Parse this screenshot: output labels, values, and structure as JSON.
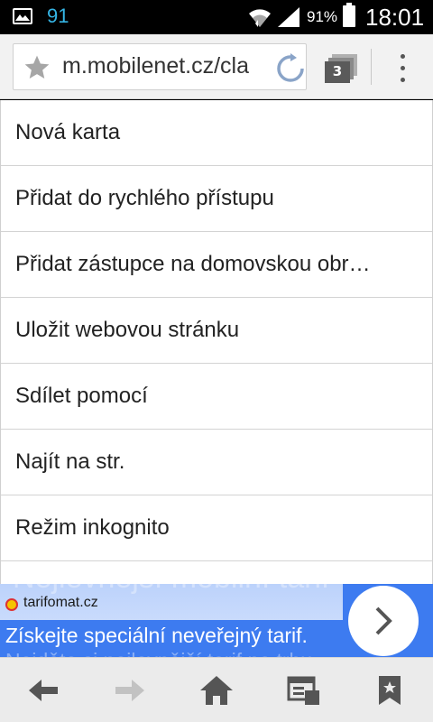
{
  "status_bar": {
    "notification_count": "91",
    "battery_percent": "91%",
    "time": "18:01",
    "icons": [
      "gallery-icon",
      "wifi-icon",
      "signal-icon",
      "battery-icon"
    ]
  },
  "toolbar": {
    "url": "m.mobilenet.cz/cla",
    "tab_count": "3",
    "icons": [
      "star-icon",
      "reload-icon",
      "tabs-icon",
      "overflow-menu-icon"
    ]
  },
  "menu": {
    "items": [
      {
        "label": "Nová karta"
      },
      {
        "label": "Přidat do rychlého přístupu"
      },
      {
        "label": "Přidat zástupce na domovskou obr…"
      },
      {
        "label": "Uložit webovou stránku"
      },
      {
        "label": "Sdílet pomocí"
      },
      {
        "label": "Najít na str."
      },
      {
        "label": "Režim inkognito"
      }
    ]
  },
  "ad": {
    "headline_partial": "Nejlevnější mobilní tarif",
    "source": "tarifomat.cz",
    "text": "Získejte speciální neveřejný tarif.",
    "text_partial": "Najděte si nejlevnější tarif na trhu",
    "accent_color": "#3d7bf0"
  },
  "bottom_nav": {
    "icons": [
      "back-arrow-icon",
      "forward-arrow-icon",
      "home-icon",
      "saved-pages-icon",
      "bookmarks-icon"
    ]
  }
}
